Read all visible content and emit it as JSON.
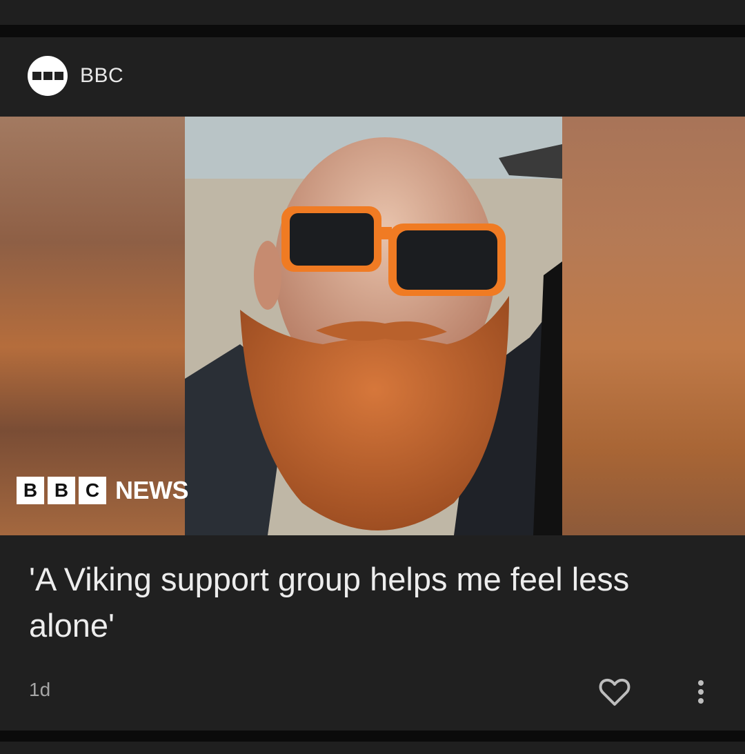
{
  "card": {
    "source_name": "BBC",
    "source_logo_icon": "bbc-logo-icon",
    "image": {
      "description_icon": "news-photo",
      "overlay_logo_letters": [
        "B",
        "B",
        "C"
      ],
      "overlay_logo_word": "NEWS"
    },
    "headline": "'A Viking support group helps me feel less alone'",
    "timestamp": "1d",
    "like_icon": "heart-outline-icon",
    "more_icon": "more-vertical-icon"
  },
  "colors": {
    "background": "#0b0b0b",
    "card": "#202020",
    "text": "#ededed",
    "muted": "#a5a5a5"
  }
}
